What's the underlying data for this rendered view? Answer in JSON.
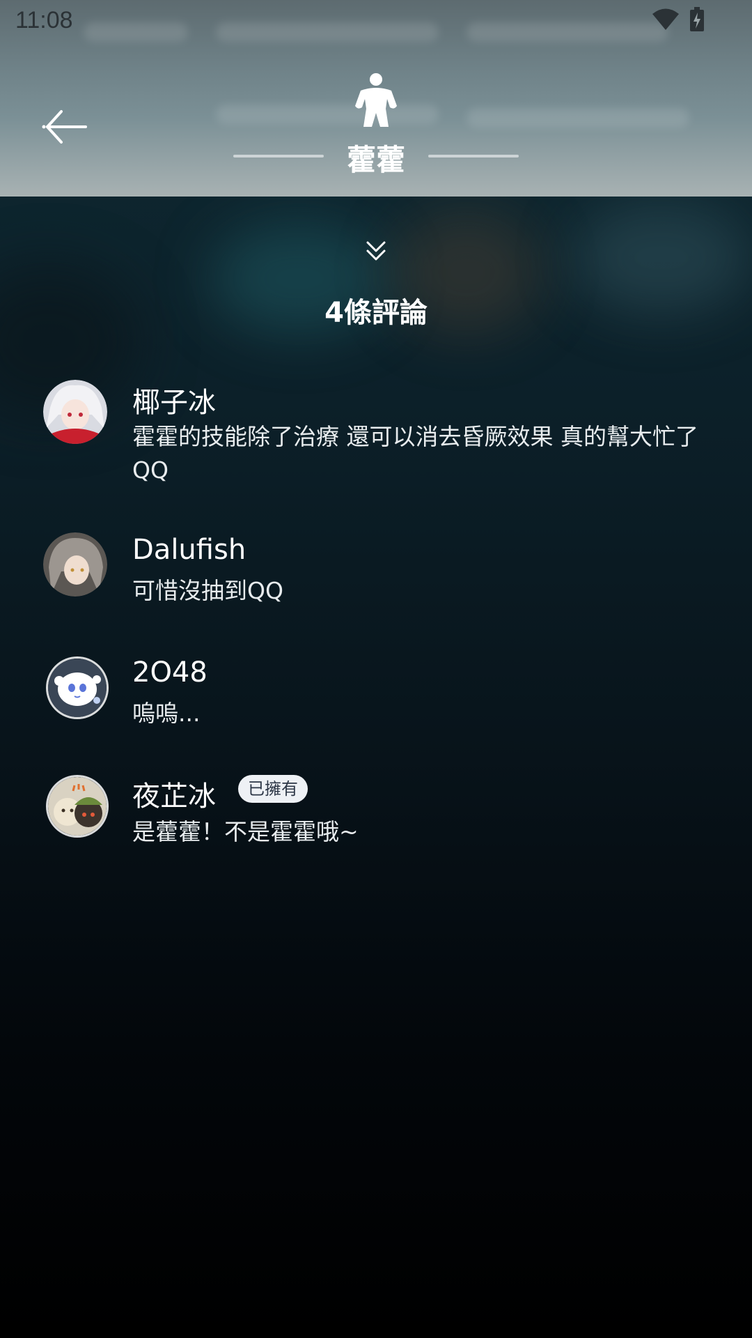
{
  "status_bar": {
    "time": "11:08",
    "icons": [
      "wifi-icon",
      "battery-charging-icon"
    ]
  },
  "header": {
    "title": "藿藿",
    "icon": "character-icon",
    "back_icon": "back-arrow-icon"
  },
  "comments_section": {
    "collapse_icon": "double-chevron-down-icon",
    "count_label": "4條評論",
    "items": [
      {
        "name": "椰子冰",
        "text": "霍霍的技能除了治療 還可以消去昏厥效果 真的幫大忙了QQ",
        "badge": ""
      },
      {
        "name": "Dalufish",
        "text": "可惜沒抽到QQ",
        "badge": ""
      },
      {
        "name": "2O48",
        "text": "嗚嗚...",
        "badge": ""
      },
      {
        "name": "夜芷冰",
        "text": "是藿藿！不是霍霍哦~",
        "badge": "已擁有"
      }
    ]
  }
}
